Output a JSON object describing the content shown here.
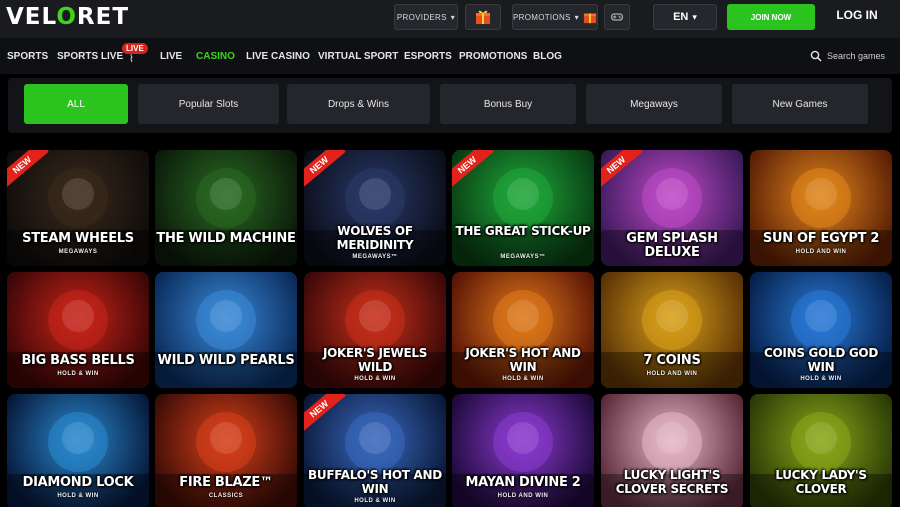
{
  "header": {
    "logo_text_a": "VEL",
    "logo_text_b": "O",
    "logo_text_c": "RET",
    "providers_label": "PROVIDERS",
    "promotions_label": "PROMOTIONS",
    "lang_label": "EN",
    "join_label": "JOIN NOW",
    "login_label": "LOG IN",
    "accent_color": "#2bc41e"
  },
  "nav": {
    "items": [
      "SPORTS",
      "SPORTS LIVE",
      "LIVE",
      "CASINO",
      "LIVE CASINO",
      "VIRTUAL SPORT",
      "ESPORTS",
      "PROMOTIONS",
      "BLOG"
    ],
    "live_badge": "LIVE",
    "active": "CASINO",
    "search_placeholder": "Search games"
  },
  "filters": {
    "items": [
      "ALL",
      "Popular Slots",
      "Drops & Wins",
      "Bonus Buy",
      "Megaways",
      "New Games"
    ],
    "active": "ALL"
  },
  "new_ribbon": "NEW",
  "games": [
    {
      "name": "STEAM WHEELS",
      "sub": "MEGAWAYS",
      "new": true,
      "bg": [
        "#3a2a1c",
        "#0f0c0a"
      ]
    },
    {
      "name": "THE WILD MACHINE",
      "sub": "",
      "new": false,
      "bg": [
        "#2a6a22",
        "#0b1a0a"
      ]
    },
    {
      "name": "WOLVES OF MERIDINITY",
      "sub": "MEGAWAYS™",
      "new": true,
      "bg": [
        "#2a3a6a",
        "#0a0d18"
      ]
    },
    {
      "name": "THE GREAT STICK-UP",
      "sub": "MEGAWAYS™",
      "new": true,
      "bg": [
        "#1fa83a",
        "#083a12"
      ]
    },
    {
      "name": "GEM SPLASH DELUXE",
      "sub": "",
      "new": true,
      "bg": [
        "#c04ac8",
        "#3a1a5a"
      ]
    },
    {
      "name": "SUN OF EGYPT 2",
      "sub": "HOLD AND WIN",
      "new": false,
      "bg": [
        "#e2861c",
        "#5a1e06"
      ]
    },
    {
      "name": "BIG BASS BELLS",
      "sub": "HOLD & WIN",
      "new": false,
      "bg": [
        "#c8241a",
        "#3a0606"
      ]
    },
    {
      "name": "WILD WILD PEARLS",
      "sub": "",
      "new": false,
      "bg": [
        "#3a8ad8",
        "#0a2a5a"
      ]
    },
    {
      "name": "JOKER'S JEWELS WILD",
      "sub": "HOLD & WIN",
      "new": false,
      "bg": [
        "#c8301a",
        "#3a0808"
      ]
    },
    {
      "name": "JOKER'S HOT AND WIN",
      "sub": "HOLD & WIN",
      "new": false,
      "bg": [
        "#e07a1a",
        "#5a1406"
      ]
    },
    {
      "name": "7 COINS",
      "sub": "HOLD AND WIN",
      "new": false,
      "bg": [
        "#d8a01a",
        "#5a3206"
      ]
    },
    {
      "name": "COINS GOLD GOD WIN",
      "sub": "HOLD & WIN",
      "new": false,
      "bg": [
        "#2a7ad8",
        "#06204a"
      ]
    },
    {
      "name": "DIAMOND LOCK",
      "sub": "HOLD & WIN",
      "new": false,
      "bg": [
        "#2a8ad0",
        "#06183a"
      ]
    },
    {
      "name": "FIRE BLAZE™",
      "sub": "CLASSICS",
      "new": false,
      "bg": [
        "#d8401a",
        "#3a0c06"
      ]
    },
    {
      "name": "BUFFALO'S HOT AND WIN",
      "sub": "HOLD & WIN",
      "new": true,
      "bg": [
        "#3a6ac0",
        "#0a1838"
      ]
    },
    {
      "name": "MAYAN DIVINE 2",
      "sub": "HOLD AND WIN",
      "new": false,
      "bg": [
        "#8a3ad0",
        "#1e0a3a"
      ]
    },
    {
      "name": "LUCKY LIGHT'S CLOVER SECRETS",
      "sub": "",
      "new": false,
      "bg": [
        "#e8b8c8",
        "#5a2a3a"
      ]
    },
    {
      "name": "LUCKY LADY'S CLOVER",
      "sub": "",
      "new": false,
      "bg": [
        "#8aa81a",
        "#2a3a06"
      ]
    }
  ]
}
